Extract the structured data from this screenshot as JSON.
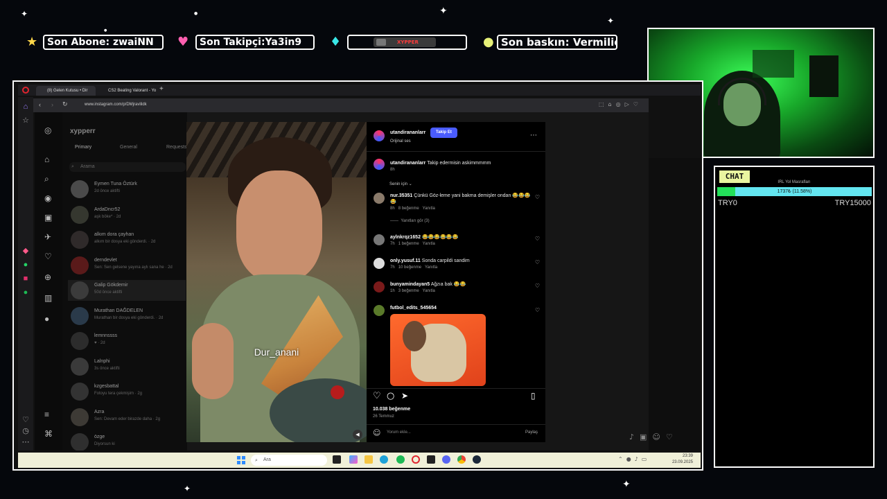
{
  "overlay": {
    "last_sub": "Son Abone: zwaiNN",
    "last_follower": "Son Takipçi:Ya3in9",
    "last_follower_tail": "So",
    "channel_logo": "XYPPER",
    "last_raid": "Son baskın: Vermilionn",
    "icons": [
      "star-icon",
      "heart-icon",
      "diamond-icon",
      "coin-icon"
    ]
  },
  "chat": {
    "title": "CHAT",
    "goal_label": "IRL Yol Masrafları",
    "goal_progress_text": "1737₺ (11.58%)",
    "goal_progress_fraction": 0.1158,
    "goal_min": "TRY0",
    "goal_max": "TRY15000"
  },
  "browser": {
    "tabs": [
      "(8) Gelen Kutusu • Dir",
      "CS2 Beating Valorant - Yo"
    ],
    "url": "www.instagram.com/p/DMjravlildk"
  },
  "instagram": {
    "username": "xypperr",
    "dm_tabs": [
      "Primary",
      "General",
      "Requests"
    ],
    "search_placeholder": "Arama",
    "conversations": [
      {
        "name": "Eymen Tuna Öztürk",
        "sub": "2d önce aktifti"
      },
      {
        "name": "ArdaDncr52",
        "sub": "aşk böke* · 2d"
      },
      {
        "name": "alkım dora çayhan",
        "sub": "alkım bir dosya eki gönderdi. · 2d"
      },
      {
        "name": "derndevlet",
        "sub": "Sen: Sen gelsene yayına aylı sana he · 2d"
      },
      {
        "name": "Galip Gökdemir",
        "sub": "50d önce aktifti"
      },
      {
        "name": "Murathan DAĞDELEN",
        "sub": "Murathan bir dosya eki gönderdi. · 2d"
      },
      {
        "name": "lemnnssss",
        "sub": "♥ · 2d"
      },
      {
        "name": "Lalnphi",
        "sub": "3s önce aktifti"
      },
      {
        "name": "kzgesbattal",
        "sub": "Fotoyu tera çekmişim · 2g"
      },
      {
        "name": "Azra",
        "sub": "Sen: Devam eder birazde daha · 2g"
      },
      {
        "name": "özge",
        "sub": "Diyorsun ki"
      }
    ]
  },
  "post": {
    "author": "utandirananlarr",
    "follow_label": "Takip Et",
    "audio": "Orijinal ses",
    "caption_user": "utandirananlarr",
    "caption": "Takip edermisin askimmmmm",
    "caption_time": "8h",
    "filter": "Senin için",
    "subtitle": "Dur_anani",
    "comments": [
      {
        "user": "nur.35351",
        "text": "Çünkü Göz-leme yani bakma demişler ondan 😂😂😂😂",
        "time": "8h",
        "likes": "8 beğenme",
        "reply": "Yanıtla",
        "replies": "Yanıtları gör (3)"
      },
      {
        "user": "aylnkrqz1652",
        "text": "😂😂😂😂😂😂",
        "time": "7h",
        "likes": "1 beğenme",
        "reply": "Yanıtla"
      },
      {
        "user": "only.yusuf.11",
        "text": "Sonda carpildi sandim",
        "time": "7h",
        "likes": "10 beğenme",
        "reply": "Yanıtla"
      },
      {
        "user": "bunyamindayan5",
        "text": "Ağzıa bak 😂😂",
        "time": "1h",
        "likes": "3 beğenme",
        "reply": "Yanıtla"
      },
      {
        "user": "futbol_edits_545654",
        "text": "",
        "time": "",
        "likes": "",
        "reply": ""
      }
    ],
    "likes": "10.038 beğenme",
    "date": "26 Temmuz",
    "comment_placeholder": "Yorum ekle...",
    "share_label": "Paylaş"
  },
  "taskbar": {
    "search_placeholder": "Ara",
    "time": "23:39",
    "date": "23.09.2025"
  },
  "colors": {
    "accent_blue": "#4a5cff",
    "goal_bar": "#63e5f0",
    "goal_fill": "#23e05a",
    "webcam_green": "#2ee04a"
  }
}
